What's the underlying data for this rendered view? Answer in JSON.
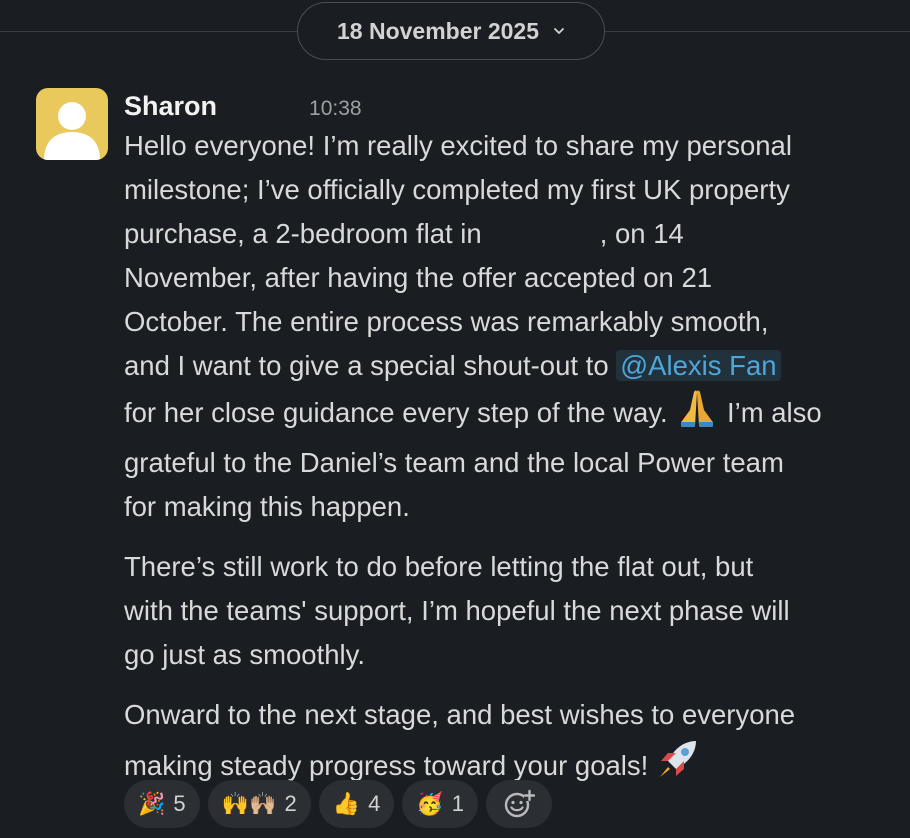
{
  "date_divider": {
    "label": "18 November 2025"
  },
  "message": {
    "author": "Sharon",
    "time": "10:38",
    "paragraph1": {
      "l1": "Hello everyone! I’m really excited to share my personal",
      "l2": "milestone; I’ve officially completed my first UK property",
      "l3a": "purchase, a 2-bedroom flat in",
      "l3b": ", on 14",
      "l4": "November, after having the offer accepted on 21",
      "l5": "October. The entire process was remarkably smooth,",
      "l6a": "and I want to give a special shout-out to",
      "mention": "@Alexis Fan",
      "l7a": "for her close guidance every step of the way.",
      "l7b": "I’m also",
      "l8": "grateful to the Daniel’s team and the local Power team",
      "l9": "for making this happen."
    },
    "paragraph2": {
      "l1": "There’s still work to do before letting the flat out, but",
      "l2": "with the teams' support, I’m hopeful the next phase will",
      "l3": "go just as smoothly."
    },
    "paragraph3": {
      "l1": "Onward to the next stage, and best wishes to everyone",
      "l2": "making steady progress toward your goals!"
    }
  },
  "reactions": [
    {
      "emoji": "🎉",
      "icon": "party-popper-icon",
      "count": "5"
    },
    {
      "emoji": "🙌🙌🏼",
      "icon": "raising-hands-icon",
      "count": "2"
    },
    {
      "emoji": "👍",
      "icon": "thumbs-up-icon",
      "count": "4"
    },
    {
      "emoji": "🥳",
      "icon": "partying-face-icon",
      "count": "1"
    }
  ],
  "colors": {
    "background": "#1a1d21",
    "mention": "#4fa6d9",
    "avatar": "#e9c85c"
  }
}
